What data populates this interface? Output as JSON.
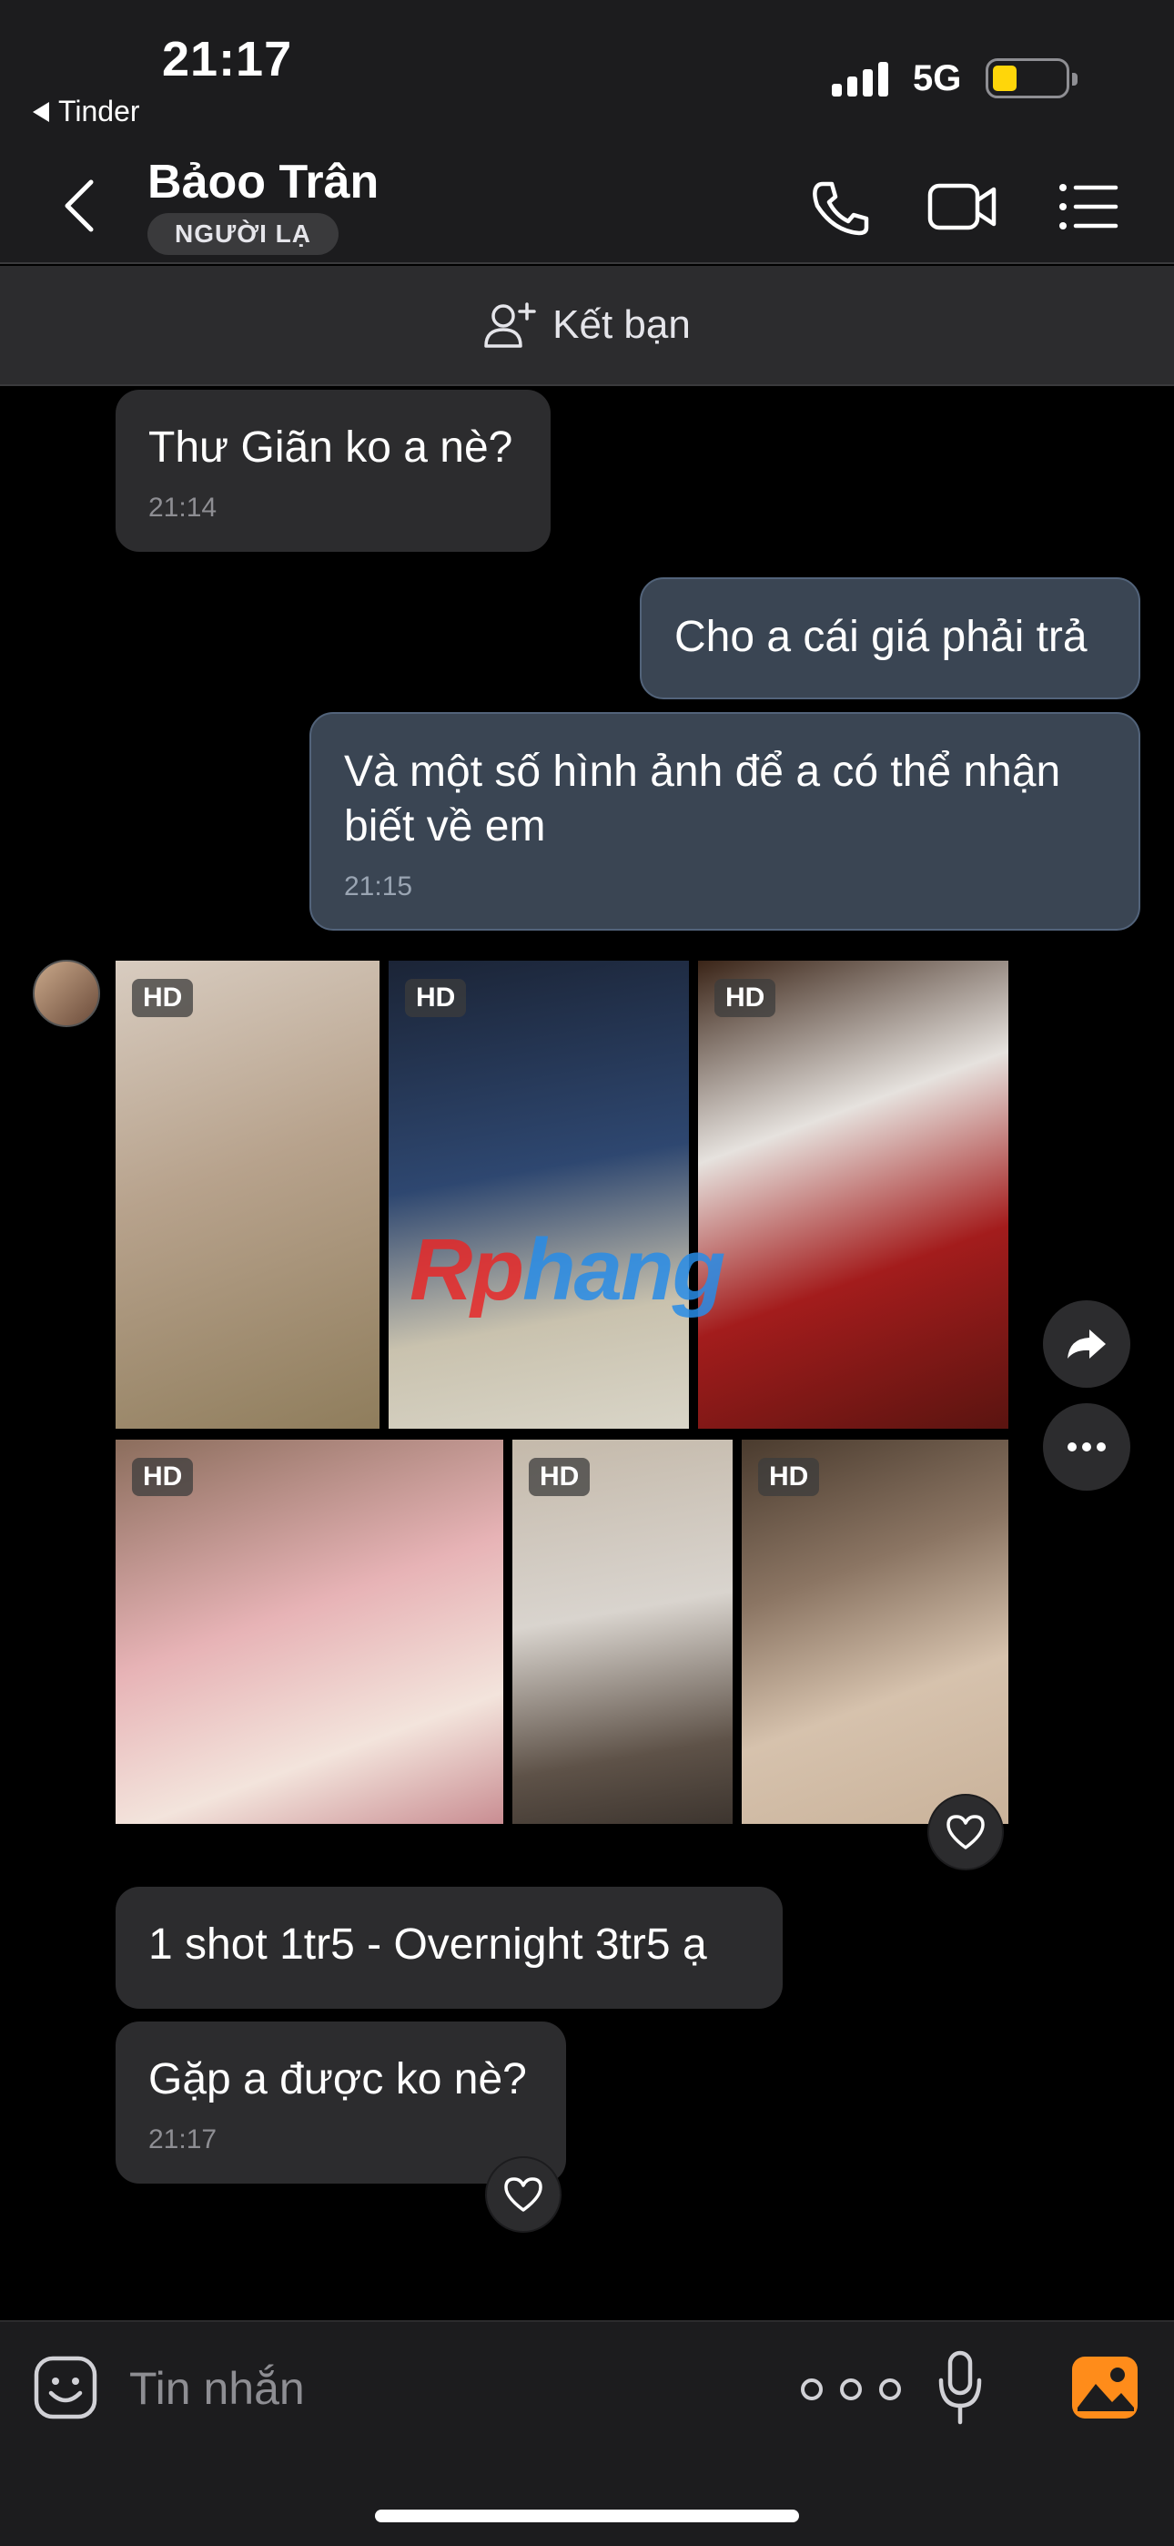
{
  "status_bar": {
    "time": "21:17",
    "back_app": "Tinder",
    "network": "5G"
  },
  "header": {
    "contact_name": "Bảoo Trân",
    "badge": "NGƯỜI LẠ"
  },
  "friend_bar": {
    "label": "Kết bạn"
  },
  "messages": [
    {
      "direction": "in",
      "text": "Thư Giãn ko a nè?",
      "time": "21:14"
    },
    {
      "direction": "out",
      "text": "Cho a cái giá phải trả",
      "time": ""
    },
    {
      "direction": "out",
      "text": "Và một số hình ảnh để a có thể nhận biết về em",
      "time": "21:15"
    },
    {
      "direction": "in",
      "text": "1 shot 1tr5 - Overnight 3tr5 ạ",
      "time": ""
    },
    {
      "direction": "in",
      "text": "Gặp a được ko nè?",
      "time": "21:17"
    }
  ],
  "photos": {
    "badge": "HD",
    "count": 6
  },
  "watermark": {
    "part1": "Rp",
    "part2": "hang"
  },
  "input": {
    "placeholder": "Tin nhắn"
  },
  "colors": {
    "outgoing_bubble": "#3a4553",
    "incoming_bubble": "#2c2c2e",
    "gallery_accent": "#ff8c1a",
    "battery": "#ffd60a"
  }
}
